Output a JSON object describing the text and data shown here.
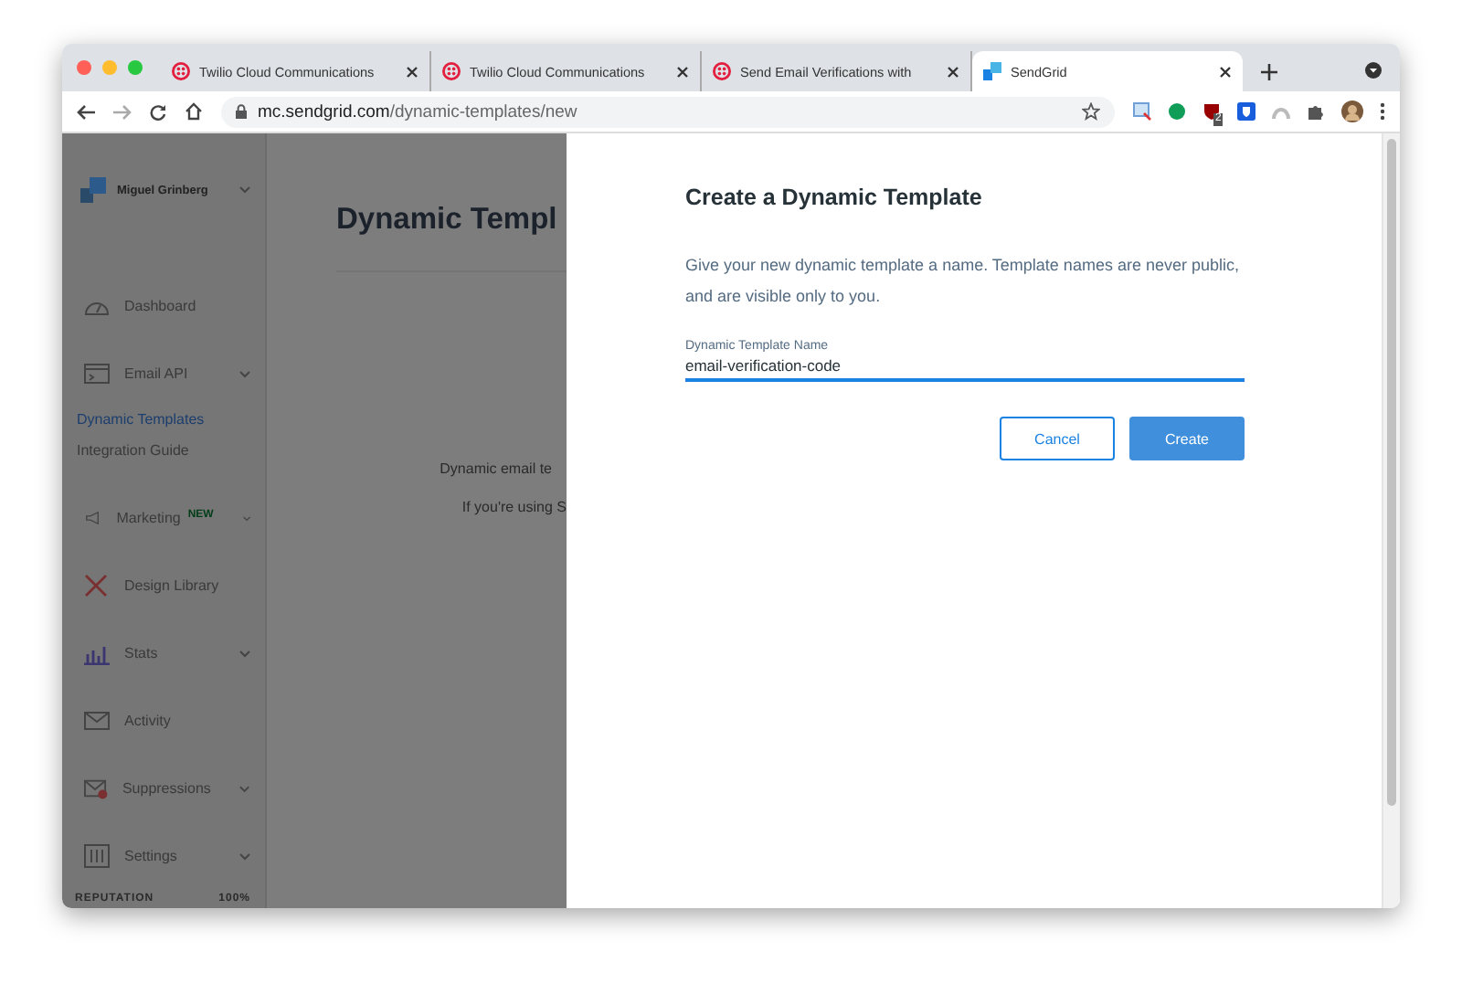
{
  "browser": {
    "tabs": [
      {
        "title": "Twilio Cloud Communications",
        "selected": false
      },
      {
        "title": "Twilio Cloud Communications",
        "selected": false
      },
      {
        "title": "Send Email Verifications with",
        "selected": false
      },
      {
        "title": "SendGrid",
        "selected": true
      }
    ],
    "url": {
      "host": "mc.sendgrid.com",
      "path": "/dynamic-templates/new"
    },
    "extension_badge": "2"
  },
  "sidebar": {
    "account": "Miguel Grinberg",
    "items": [
      {
        "label": "Dashboard",
        "dropdown": false,
        "selected": false
      },
      {
        "label": "Email API",
        "dropdown": true,
        "selected": false,
        "children": [
          {
            "label": "Dynamic Templates",
            "selected": true
          },
          {
            "label": "Integration Guide",
            "selected": false
          }
        ]
      },
      {
        "label": "Marketing",
        "badge": "NEW",
        "dropdown": true,
        "selected": false
      },
      {
        "label": "Design Library",
        "dropdown": false,
        "selected": false
      },
      {
        "label": "Stats",
        "dropdown": true,
        "selected": false
      },
      {
        "label": "Activity",
        "dropdown": false,
        "selected": false
      },
      {
        "label": "Suppressions",
        "dropdown": true,
        "selected": false
      },
      {
        "label": "Settings",
        "dropdown": true,
        "selected": false
      }
    ],
    "reputation": {
      "label": "REPUTATION",
      "value": "100%"
    }
  },
  "page": {
    "heading": "Dynamic Templ",
    "lines": [
      "Dynamic email te",
      "If you're using S"
    ]
  },
  "modal": {
    "title": "Create a Dynamic Template",
    "description": "Give your new dynamic template a name. Template names are never public, and are visible only to you.",
    "field": {
      "label": "Dynamic Template Name",
      "value": "email-verification-code"
    },
    "buttons": [
      {
        "label": "Cancel",
        "kind": "secondary"
      },
      {
        "label": "Create",
        "kind": "primary"
      }
    ]
  }
}
